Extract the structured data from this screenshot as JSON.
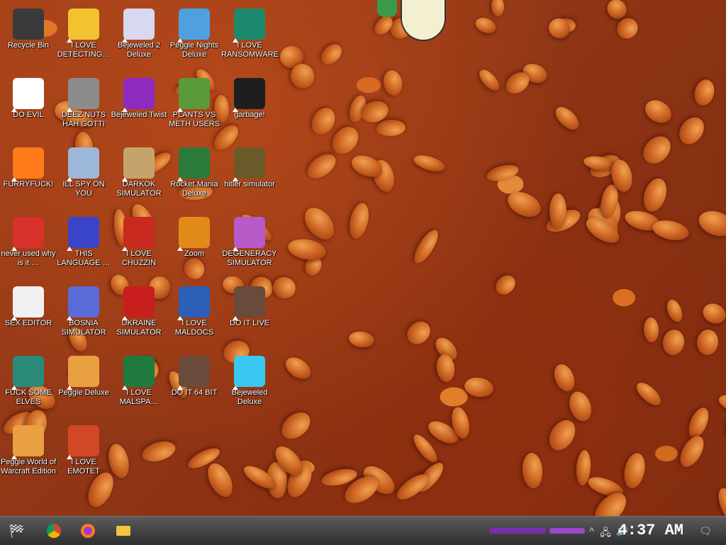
{
  "desktop": {
    "icons": [
      {
        "label": "Recycle Bin",
        "icon": "recycle-bin-icon",
        "color": "#3a3a3a"
      },
      {
        "label": "I LOVE DETECTING…",
        "icon": "detect-it-easy-icon",
        "color": "#f2c230"
      },
      {
        "label": "Bejeweled 2 Deluxe",
        "icon": "bejeweled-2-icon",
        "color": "#d8d8f0"
      },
      {
        "label": "Peggle Nights Deluxe",
        "icon": "peggle-nights-icon",
        "color": "#4ea0e0"
      },
      {
        "label": "I LOVE RANSOMWARE",
        "icon": "publisher-icon",
        "color": "#1d8a70"
      },
      {
        "label": "DO EVIL",
        "icon": "chrome-icon",
        "color": "#ffffff"
      },
      {
        "label": "DEEZ NUTS HAH GOTTI",
        "icon": "windows-stack-icon",
        "color": "#8c8c8c"
      },
      {
        "label": "Bejeweled Twist",
        "icon": "bejeweled-twist-icon",
        "color": "#8f2ac0"
      },
      {
        "label": "PLANTS VS METH USERS",
        "icon": "plants-vs-zombies-icon",
        "color": "#5a9a3a"
      },
      {
        "label": "garbage!",
        "icon": "paradox-icon",
        "color": "#1e1e1e"
      },
      {
        "label": "FURRYFUCK!",
        "icon": "firefox-icon",
        "color": "#ff7a1a"
      },
      {
        "label": "ILL SPY ON YOU",
        "icon": "network-icon",
        "color": "#9db7d8"
      },
      {
        "label": "DARKOK SIMULATOR",
        "icon": "money-bag-icon",
        "color": "#c4a46a"
      },
      {
        "label": "Rocket Mania Deluxe",
        "icon": "rocket-mania-icon",
        "color": "#2a7a3a"
      },
      {
        "label": "hitler simulator",
        "icon": "hearts-of-iron-icon",
        "color": "#6a5a2a"
      },
      {
        "label": "never used why is it …",
        "icon": "dev-cpp-icon",
        "color": "#d8302a"
      },
      {
        "label": "THIS LANGUAGE …",
        "icon": "goland-icon",
        "color": "#3a44c8"
      },
      {
        "label": "I LOVE CHUZZIN",
        "icon": "chuzzle-icon",
        "color": "#c82a20"
      },
      {
        "label": "Zoom",
        "icon": "zuma-icon",
        "color": "#e08a1a"
      },
      {
        "label": "DEGENERACY SIMULATOR",
        "icon": "paradox-logo-icon",
        "color": "#b85ac8"
      },
      {
        "label": "SEX EDITOR",
        "icon": "hxd-icon",
        "color": "#f0f0f0"
      },
      {
        "label": "BOSNIA SIMULATOR",
        "icon": "mine-icon",
        "color": "#5a6ad8"
      },
      {
        "label": "UKRAINE SIMULATOR",
        "icon": "radiation-icon",
        "color": "#c81e1e"
      },
      {
        "label": "I LOVE MALDOCS",
        "icon": "word-icon",
        "color": "#2b5fb8"
      },
      {
        "label": "DO IT LIVE",
        "icon": "portrait-icon",
        "color": "#6a4a3a"
      },
      {
        "label": "FUCK SOME ELVES",
        "icon": "santa-icon",
        "color": "#2a8a7a"
      },
      {
        "label": "Peggle Deluxe",
        "icon": "peggle-icon",
        "color": "#e8a040"
      },
      {
        "label": "I LOVE MALSPA…",
        "icon": "excel-icon",
        "color": "#1f7a3e"
      },
      {
        "label": "DO IT 64 BIT",
        "icon": "portrait-64-icon",
        "color": "#6a4a3a"
      },
      {
        "label": "Bejeweled Deluxe",
        "icon": "diamond-icon",
        "color": "#3ac8f0"
      },
      {
        "label": "Peggle World of Warcraft Edition",
        "icon": "peggle-wow-icon",
        "color": "#e8a040"
      },
      {
        "label": "I LOVE EMOTET",
        "icon": "powerpoint-icon",
        "color": "#d24726"
      }
    ]
  },
  "taskbar": {
    "start": {
      "icon": "start-icon"
    },
    "pinned": [
      {
        "name": "chrome",
        "icon": "chrome-icon"
      },
      {
        "name": "firefox",
        "icon": "firefox-icon"
      },
      {
        "name": "file-explorer",
        "icon": "folder-icon"
      }
    ],
    "tray": {
      "chevron": "^",
      "clock": "4:37 AM"
    }
  }
}
